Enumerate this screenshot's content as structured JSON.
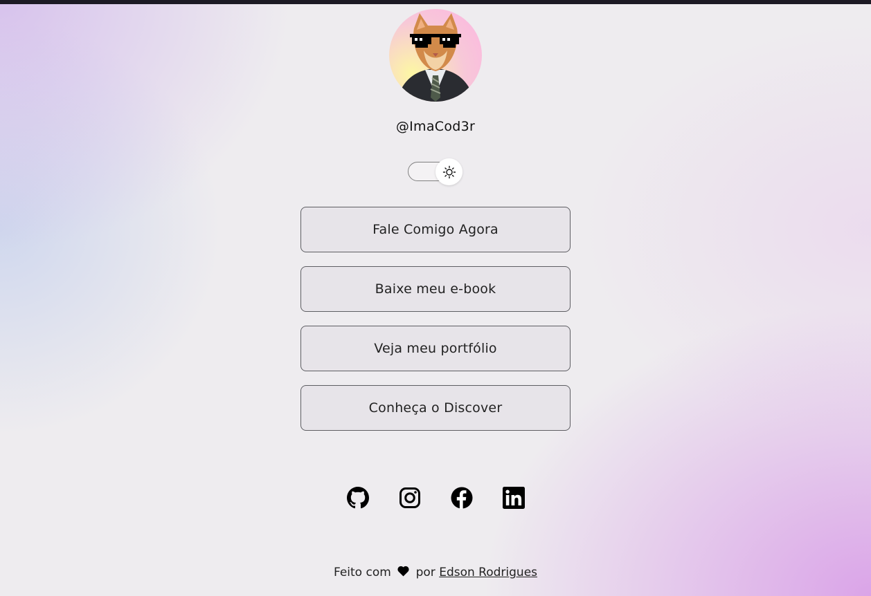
{
  "profile": {
    "handle": "@ImaCod3r",
    "avatar_icon": "cat-in-suit-with-sunglasses-avatar"
  },
  "theme_toggle": {
    "icon": "sun-icon",
    "state": "light"
  },
  "links": [
    {
      "label": "Fale Comigo Agora"
    },
    {
      "label": "Baixe meu e-book"
    },
    {
      "label": "Veja meu portfólio"
    },
    {
      "label": "Conheça o Discover"
    }
  ],
  "socials": [
    {
      "name": "github",
      "icon": "github-icon"
    },
    {
      "name": "instagram",
      "icon": "instagram-icon"
    },
    {
      "name": "facebook",
      "icon": "facebook-icon"
    },
    {
      "name": "linkedin",
      "icon": "linkedin-icon"
    }
  ],
  "footer": {
    "prefix": "Feito com",
    "middle": "por",
    "author": "Edson Rodrigues",
    "heart_icon": "heart-icon"
  },
  "colors": {
    "top_bar": "#1c1a24",
    "button_border": "#5d5d62",
    "accent_purple": "#d48ce6"
  }
}
